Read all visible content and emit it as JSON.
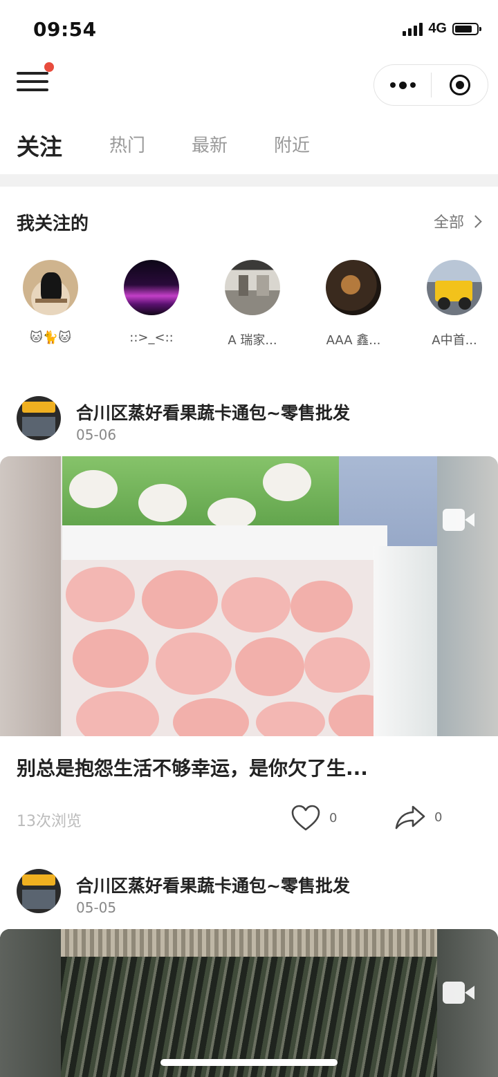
{
  "status_bar": {
    "time": "09:54",
    "network": "4G"
  },
  "header": {
    "menu_icon": "hamburger-icon",
    "more_icon": "more-dots-icon",
    "close_icon": "target-icon"
  },
  "tabs": [
    {
      "label": "关注",
      "active": true
    },
    {
      "label": "热门",
      "active": false
    },
    {
      "label": "最新",
      "active": false
    },
    {
      "label": "附近",
      "active": false
    }
  ],
  "following": {
    "title": "我关注的",
    "all_label": "全部",
    "items": [
      {
        "name": "🐱🐈🐱"
      },
      {
        "name": "::>_<::"
      },
      {
        "name": "A 瑞家..."
      },
      {
        "name": "AAA 鑫..."
      },
      {
        "name": "A中首..."
      }
    ]
  },
  "posts": [
    {
      "author": "合川区蒸好看果蔬卡通包~零售批发",
      "date": "05-06",
      "text": "别总是抱怨生活不够幸运，是你欠了生...",
      "views": "13次浏览",
      "likes": "0",
      "shares": "0"
    },
    {
      "author": "合川区蒸好看果蔬卡通包~零售批发",
      "date": "05-05"
    }
  ],
  "colors": {
    "accent_dot": "#e84c3d",
    "divider": "#f1f1f1"
  }
}
